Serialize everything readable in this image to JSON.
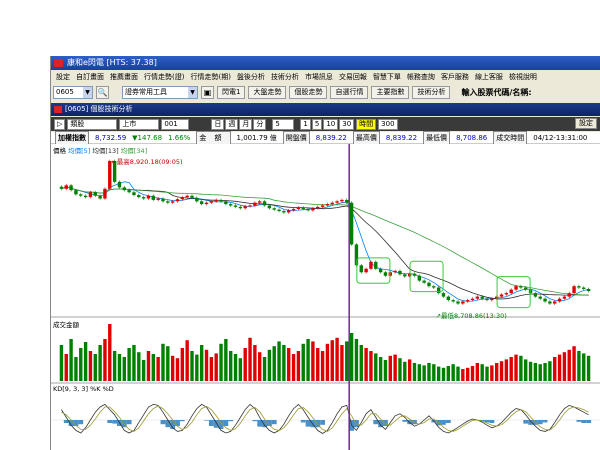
{
  "window": {
    "title": "康和e閃電 [HTS: 37.38]"
  },
  "menu": [
    "設定",
    "自訂畫面",
    "推薦畫面",
    "行情走勢(證)",
    "行情走勢(期)",
    "盤後分析",
    "技術分析",
    "市場訊息",
    "交易回報",
    "智慧下單",
    "帳務查詢",
    "客戶服務",
    "線上客服",
    "檢視說明"
  ],
  "toolbar": {
    "code": "0605",
    "tool_select": "證券常用工具",
    "buttons": [
      "閃電1",
      "大盤走勢",
      "個股走勢",
      "自選行情",
      "主要指數",
      "技術分析"
    ],
    "prompt": "輸入股票代碼/名稱:"
  },
  "subwindow": {
    "title": "[0605] 個股技術分析"
  },
  "controls": {
    "play": "▷",
    "type": "類股",
    "market": "上市",
    "code": "001",
    "periods": [
      "日",
      "週",
      "月",
      "分"
    ],
    "minute": "5",
    "counts": [
      "1",
      "5",
      "10",
      "30"
    ],
    "active_period": "時間",
    "bars": "300",
    "settings": "設定"
  },
  "info": {
    "name": "加權指數",
    "price": "8,732.59",
    "change": "▼147.68",
    "change_pct": "1.66%",
    "amount_label": "金",
    "amount": "額",
    "amount_value": "1,001.79",
    "unit": "億",
    "open_label": "開盤價",
    "open": "8,839.22",
    "high_label": "最高價",
    "high": "8,839.22",
    "low_label": "最低價",
    "low": "8,708.86",
    "time_label": "成交時間",
    "time": "04/12-13:31:00"
  },
  "chart_labels": {
    "price_pane": "價格",
    "ma1": "均價[5]",
    "ma2": "均價[13]",
    "ma3": "均價[34]",
    "high_annot": "最高8,920.18(09:05)",
    "low_annot": "最低8,708.86(13:30)",
    "volume_pane": "成交金額",
    "kd_pane": "KD[9, 3, 3]",
    "k_label": "%K",
    "d_label": "%D"
  },
  "colors": {
    "up": "#e00000",
    "down": "#008000",
    "ma5": "#0080ff",
    "ma13": "#2c2c2c",
    "ma34": "#3aa03a",
    "highlight": "#33cc33",
    "divider": "#6a2b8a"
  },
  "chart_data": {
    "type": "candlestick",
    "title": "個股技術分析",
    "price_range": [
      8700,
      8930
    ],
    "annotations": [
      {
        "label": "最高8,920.18(09:05)",
        "value": 8920.18
      },
      {
        "label": "最低8,708.86(13:30)",
        "value": 8708.86
      }
    ],
    "candles_close": [
      8880,
      8885,
      8878,
      8872,
      8870,
      8868,
      8875,
      8870,
      8866,
      8880,
      8920,
      8890,
      8882,
      8878,
      8875,
      8871,
      8868,
      8866,
      8870,
      8864,
      8866,
      8862,
      8860,
      8862,
      8865,
      8868,
      8870,
      8867,
      8862,
      8858,
      8860,
      8862,
      8864,
      8862,
      8858,
      8856,
      8854,
      8852,
      8855,
      8856,
      8860,
      8862,
      8856,
      8852,
      8850,
      8848,
      8846,
      8849,
      8851,
      8853,
      8851,
      8849,
      8852,
      8854,
      8856,
      8858,
      8860,
      8862,
      8864,
      8860,
      8800,
      8770,
      8760,
      8765,
      8775,
      8765,
      8760,
      8755,
      8760,
      8762,
      8757,
      8754,
      8758,
      8755,
      8748,
      8745,
      8740,
      8738,
      8730,
      8725,
      8720,
      8718,
      8715,
      8718,
      8720,
      8722,
      8725,
      8722,
      8720,
      8722,
      8725,
      8728,
      8730,
      8735,
      8740,
      8738,
      8735,
      8730,
      8725,
      8722,
      8718,
      8715,
      8718,
      8722,
      8725,
      8730,
      8740,
      8738,
      8736,
      8733
    ],
    "volume": [
      60,
      45,
      70,
      40,
      55,
      65,
      50,
      45,
      60,
      70,
      95,
      50,
      45,
      40,
      55,
      60,
      48,
      35,
      50,
      45,
      40,
      62,
      58,
      42,
      38,
      55,
      68,
      50,
      44,
      60,
      52,
      40,
      46,
      62,
      70,
      50,
      45,
      38,
      55,
      72,
      60,
      48,
      40,
      52,
      58,
      66,
      60,
      55,
      45,
      50,
      62,
      70,
      66,
      55,
      50,
      62,
      68,
      72,
      60,
      66,
      80,
      70,
      60,
      55,
      50,
      46,
      40,
      35,
      42,
      44,
      38,
      32,
      36,
      30,
      28,
      26,
      30,
      28,
      24,
      22,
      25,
      28,
      24,
      20,
      22,
      25,
      30,
      28,
      24,
      26,
      30,
      33,
      36,
      40,
      44,
      42,
      36,
      32,
      30,
      28,
      30,
      33,
      40,
      44,
      48,
      52,
      58,
      50,
      46,
      42
    ],
    "k": [
      70,
      55,
      40,
      30,
      25,
      35,
      50,
      65,
      75,
      80,
      70,
      60,
      45,
      30,
      25,
      30,
      45,
      60,
      75,
      80,
      78,
      65,
      50,
      35,
      28,
      30,
      42,
      58,
      72,
      80,
      75,
      60,
      45,
      30,
      25,
      28,
      40,
      55,
      70,
      80,
      72,
      55,
      40,
      30,
      25,
      30,
      42,
      58,
      72,
      80,
      70,
      55,
      42,
      30,
      24,
      30,
      45,
      62,
      75,
      78,
      40,
      30,
      45,
      62,
      70,
      55,
      40,
      32,
      45,
      58,
      62,
      55,
      45,
      38,
      42,
      50,
      58,
      48,
      36,
      28,
      25,
      30,
      36,
      42,
      48,
      52,
      50,
      46,
      40,
      35,
      38,
      45,
      55,
      65,
      72,
      70,
      60,
      48,
      38,
      30,
      28,
      32,
      45,
      60,
      72,
      78,
      75,
      70,
      65,
      60
    ],
    "d": [
      65,
      60,
      50,
      40,
      32,
      32,
      40,
      52,
      65,
      75,
      75,
      66,
      55,
      42,
      32,
      28,
      35,
      48,
      62,
      72,
      77,
      72,
      62,
      50,
      38,
      32,
      36,
      46,
      60,
      72,
      76,
      70,
      58,
      45,
      35,
      30,
      33,
      44,
      58,
      70,
      74,
      66,
      52,
      40,
      32,
      30,
      35,
      46,
      60,
      72,
      74,
      66,
      54,
      42,
      32,
      28,
      35,
      48,
      62,
      72,
      58,
      42,
      40,
      50,
      62,
      62,
      52,
      42,
      40,
      48,
      56,
      58,
      52,
      45,
      42,
      45,
      52,
      52,
      45,
      36,
      30,
      28,
      32,
      38,
      44,
      49,
      50,
      48,
      44,
      40,
      38,
      41,
      48,
      58,
      66,
      70,
      66,
      56,
      46,
      37,
      32,
      31,
      38,
      50,
      63,
      72,
      75,
      73,
      70,
      65
    ]
  }
}
